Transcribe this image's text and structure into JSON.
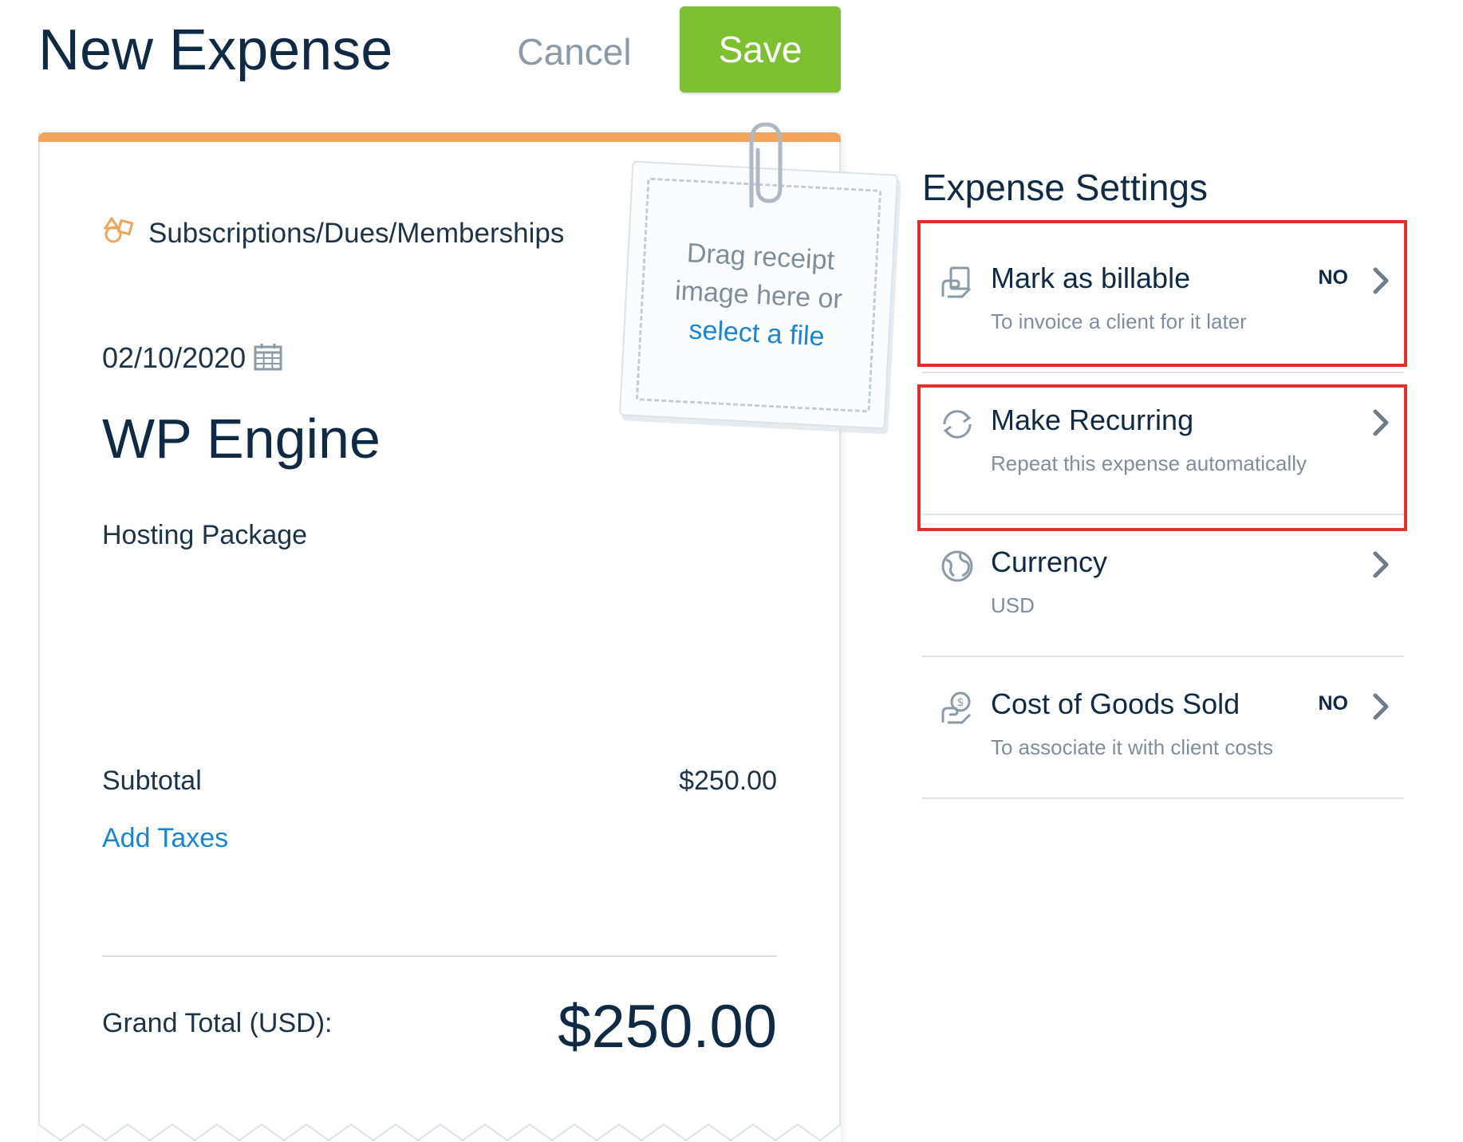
{
  "header": {
    "title": "New Expense",
    "cancel_label": "Cancel",
    "save_label": "Save"
  },
  "receipt": {
    "category": "Subscriptions/Dues/Memberships",
    "date": "02/10/2020",
    "vendor": "WP Engine",
    "description": "Hosting Package",
    "subtotal_label": "Subtotal",
    "subtotal_value": "$250.00",
    "add_taxes_label": "Add Taxes",
    "grand_total_label": "Grand Total (USD):",
    "grand_total_value": "$250.00"
  },
  "dropzone": {
    "line1": "Drag receipt",
    "line2": "image here or",
    "link": "select a file"
  },
  "settings": {
    "title": "Expense Settings",
    "items": [
      {
        "icon": "billable-hand-icon",
        "label": "Mark as billable",
        "sub": "To invoice a client for it later",
        "badge": "NO",
        "highlighted": true
      },
      {
        "icon": "recurring-arrows-icon",
        "label": "Make Recurring",
        "sub": "Repeat this expense automatically",
        "badge": "",
        "highlighted": true
      },
      {
        "icon": "globe-icon",
        "label": "Currency",
        "sub": "USD",
        "badge": "",
        "highlighted": false
      },
      {
        "icon": "cost-of-goods-icon",
        "label": "Cost of Goods Sold",
        "sub": "To associate it with client costs",
        "badge": "NO",
        "highlighted": false
      }
    ]
  },
  "colors": {
    "save_button": "#7dc132",
    "receipt_accent": "#f2a55a",
    "link": "#1a84d6",
    "highlight_box": "#e0322c"
  }
}
